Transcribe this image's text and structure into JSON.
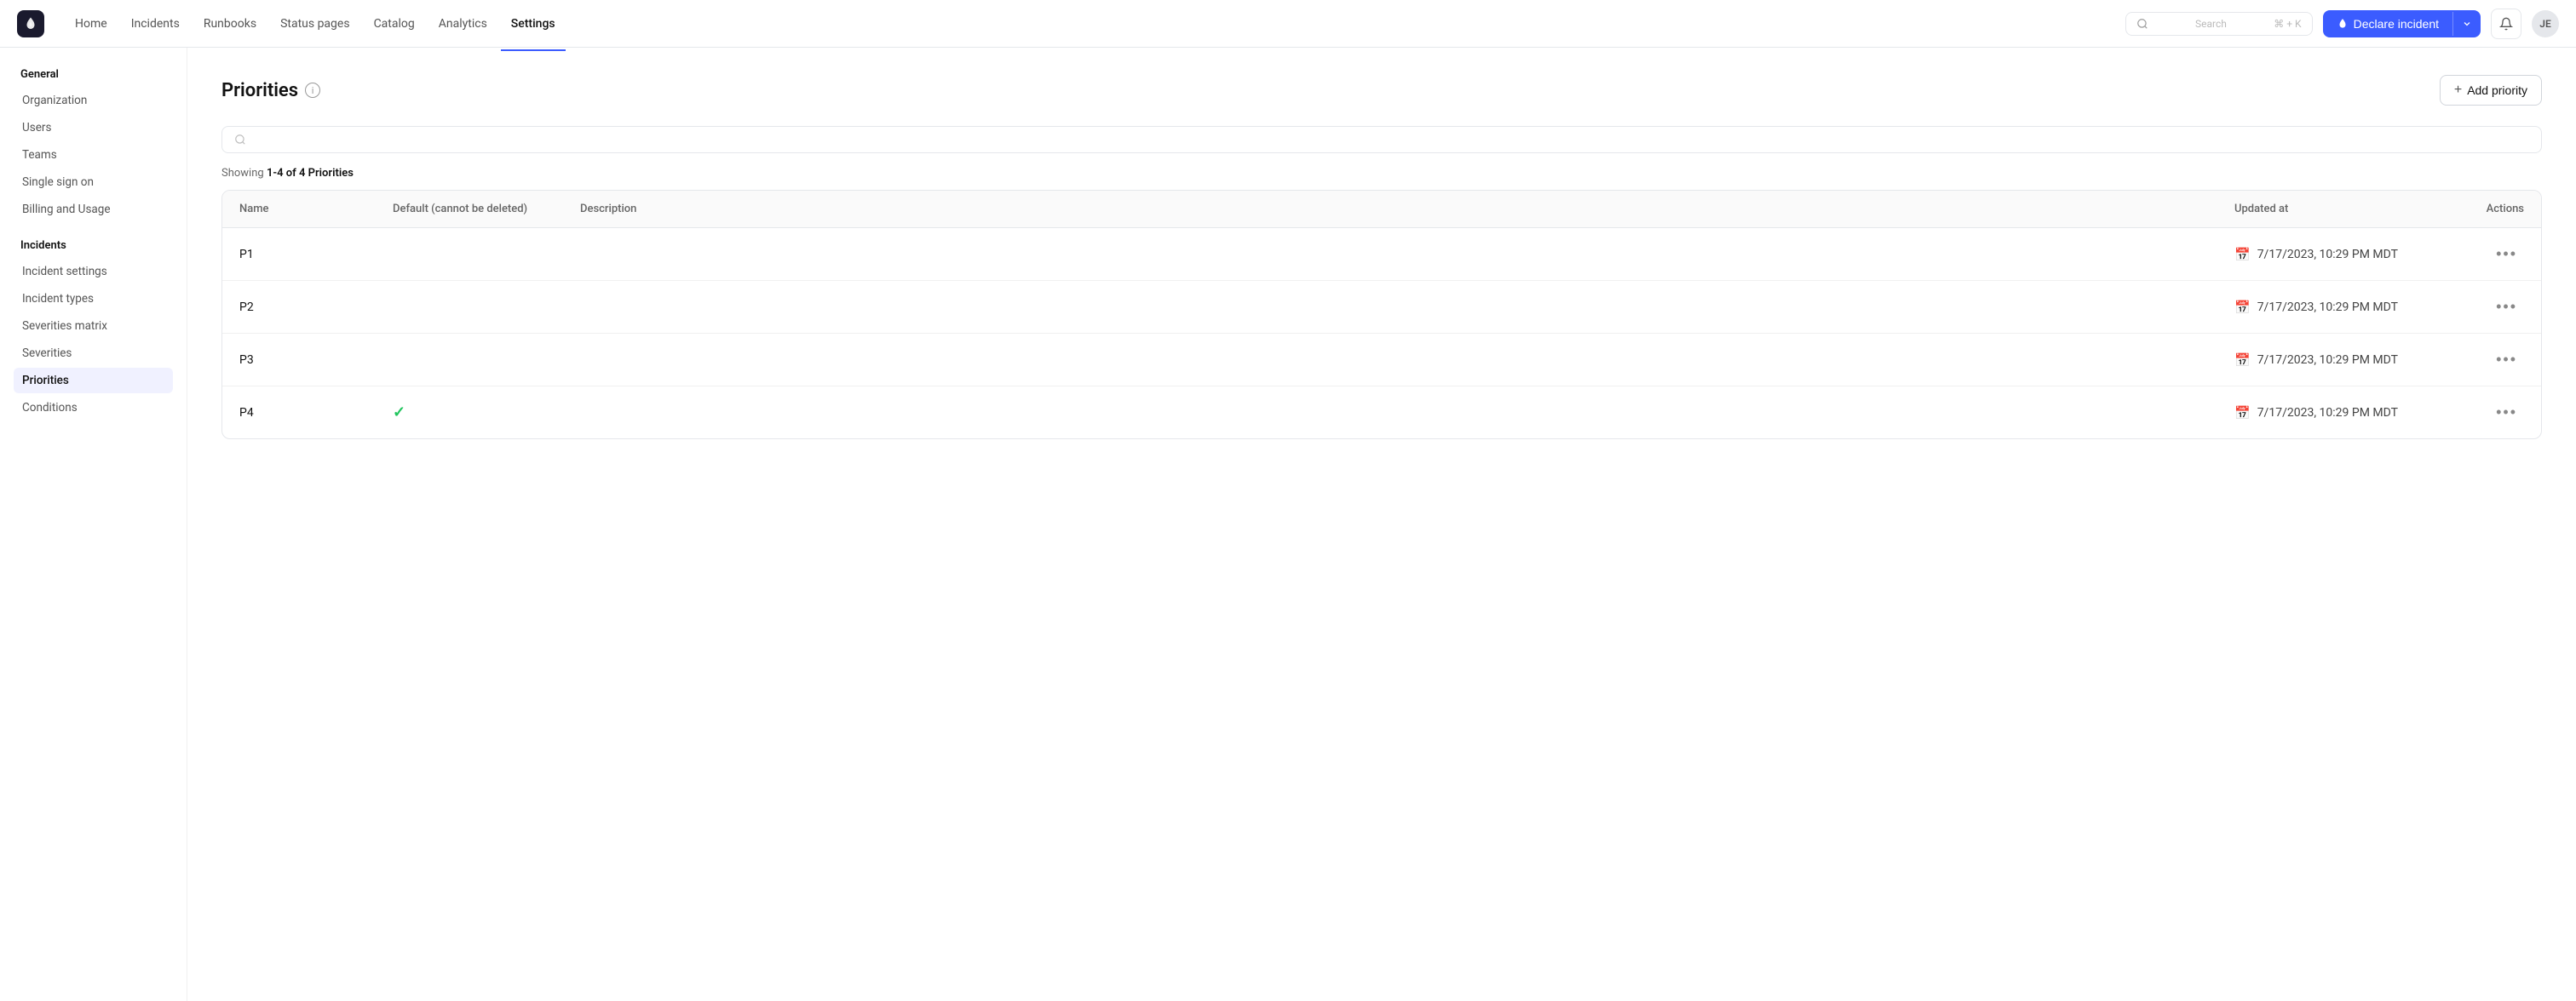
{
  "app": {
    "logo_text": "🔥",
    "nav_links": [
      {
        "label": "Home",
        "active": false
      },
      {
        "label": "Incidents",
        "active": false
      },
      {
        "label": "Runbooks",
        "active": false
      },
      {
        "label": "Status pages",
        "active": false
      },
      {
        "label": "Catalog",
        "active": false
      },
      {
        "label": "Analytics",
        "active": false
      },
      {
        "label": "Settings",
        "active": true
      }
    ],
    "search_placeholder": "Search",
    "search_shortcut": "⌘ + K",
    "declare_btn_label": "Declare incident",
    "avatar_label": "JE"
  },
  "sidebar": {
    "general_title": "General",
    "general_items": [
      {
        "label": "Organization",
        "active": false
      },
      {
        "label": "Users",
        "active": false
      },
      {
        "label": "Teams",
        "active": false
      },
      {
        "label": "Single sign on",
        "active": false
      },
      {
        "label": "Billing and Usage",
        "active": false
      }
    ],
    "incidents_title": "Incidents",
    "incidents_items": [
      {
        "label": "Incident settings",
        "active": false
      },
      {
        "label": "Incident types",
        "active": false
      },
      {
        "label": "Severities matrix",
        "active": false
      },
      {
        "label": "Severities",
        "active": false
      },
      {
        "label": "Priorities",
        "active": true
      },
      {
        "label": "Conditions",
        "active": false
      }
    ]
  },
  "main": {
    "page_title": "Priorities",
    "add_priority_label": "Add priority",
    "search_placeholder": "",
    "showing_text": "Showing ",
    "showing_range": "1-4 of 4 Priorities",
    "table": {
      "columns": [
        {
          "label": "Name"
        },
        {
          "label": "Default (cannot be deleted)"
        },
        {
          "label": "Description"
        },
        {
          "label": "Updated at"
        },
        {
          "label": "Actions"
        }
      ],
      "rows": [
        {
          "name": "P1",
          "is_default": false,
          "description": "",
          "updated_at": "7/17/2023, 10:29 PM MDT"
        },
        {
          "name": "P2",
          "is_default": false,
          "description": "",
          "updated_at": "7/17/2023, 10:29 PM MDT"
        },
        {
          "name": "P3",
          "is_default": false,
          "description": "",
          "updated_at": "7/17/2023, 10:29 PM MDT"
        },
        {
          "name": "P4",
          "is_default": true,
          "description": "",
          "updated_at": "7/17/2023, 10:29 PM MDT"
        }
      ]
    }
  }
}
